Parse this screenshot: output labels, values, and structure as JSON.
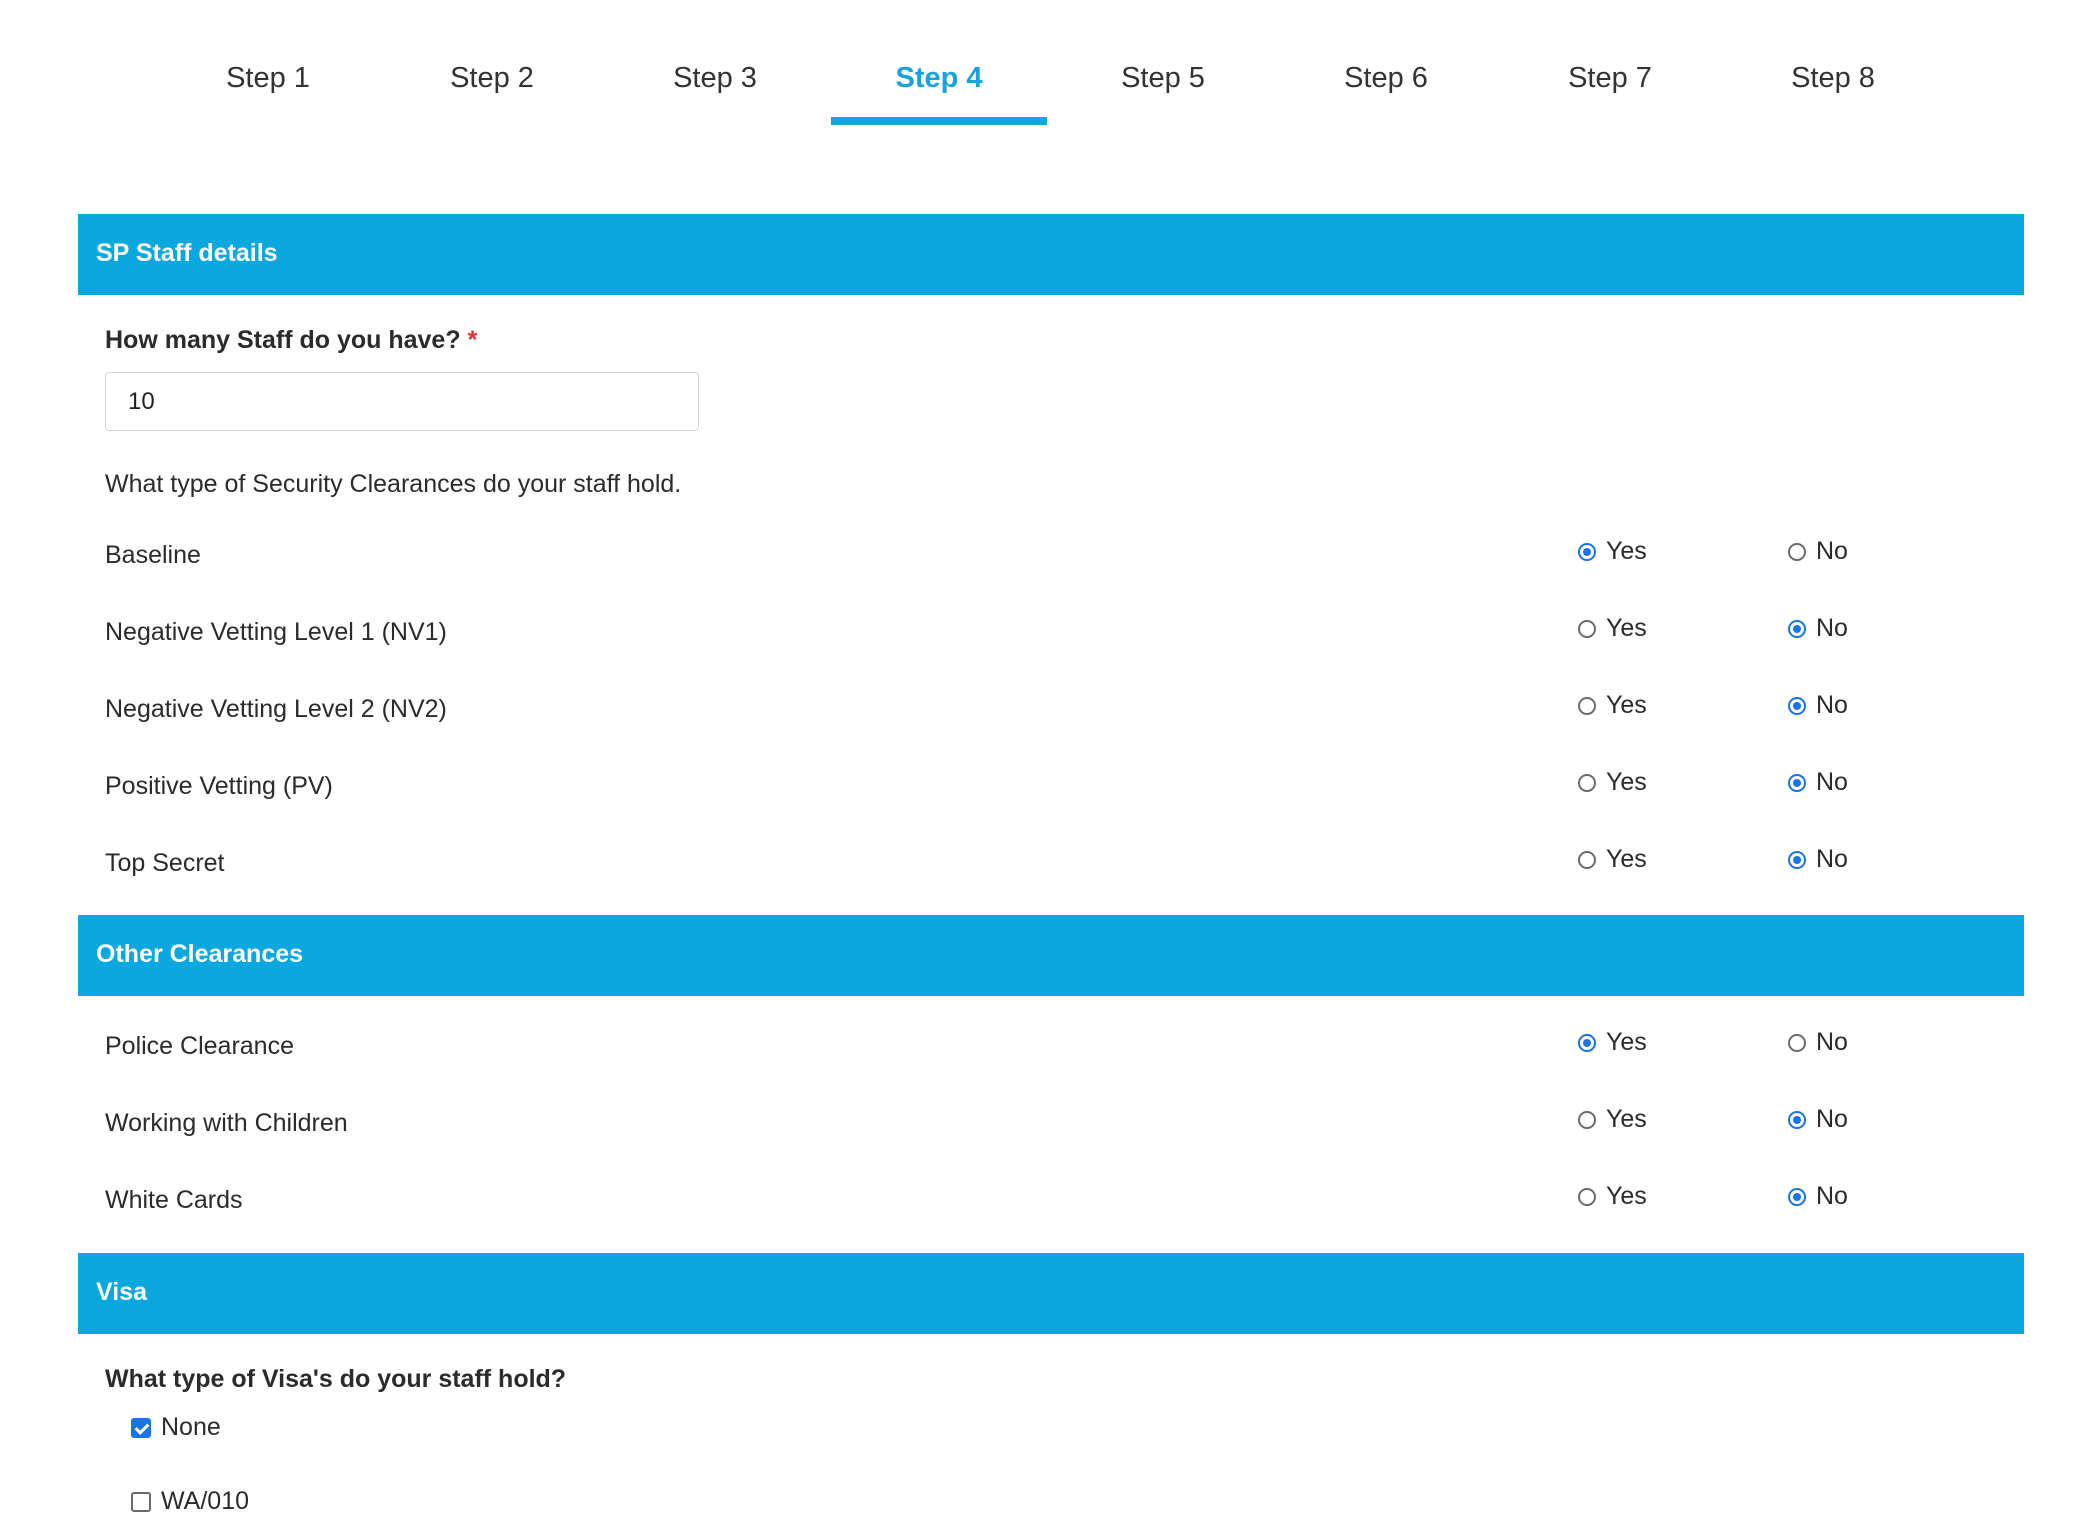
{
  "tabs": [
    {
      "label": "Step 1",
      "active": false
    },
    {
      "label": "Step 2",
      "active": false
    },
    {
      "label": "Step 3",
      "active": false
    },
    {
      "label": "Step 4",
      "active": true
    },
    {
      "label": "Step 5",
      "active": false
    },
    {
      "label": "Step 6",
      "active": false
    },
    {
      "label": "Step 7",
      "active": false
    },
    {
      "label": "Step 8",
      "active": false
    }
  ],
  "colors": {
    "accent": "#0aa8df",
    "active_tab": "#1aa2de",
    "required": "#e03131",
    "control": "#1a73e8"
  },
  "staff_section": {
    "title": "SP Staff details",
    "staff_question": "How many Staff do you have?",
    "required_mark": "*",
    "staff_value": "10",
    "clearance_prompt": "What type of Security Clearances do your staff hold.",
    "clearances": [
      {
        "label": "Baseline",
        "selected": "Yes"
      },
      {
        "label": "Negative Vetting Level 1 (NV1)",
        "selected": "No"
      },
      {
        "label": "Negative Vetting Level 2 (NV2)",
        "selected": "No"
      },
      {
        "label": "Positive Vetting (PV)",
        "selected": "No"
      },
      {
        "label": "Top Secret",
        "selected": "No"
      }
    ]
  },
  "radio_labels": {
    "yes": "Yes",
    "no": "No"
  },
  "other_section": {
    "title": "Other Clearances",
    "items": [
      {
        "label": "Police Clearance",
        "selected": "Yes"
      },
      {
        "label": "Working with Children",
        "selected": "No"
      },
      {
        "label": "White Cards",
        "selected": "No"
      }
    ]
  },
  "visa_section": {
    "title": "Visa",
    "question": "What type of Visa's do your staff hold?",
    "options": [
      {
        "label": "None",
        "checked": true
      },
      {
        "label": "WA/010",
        "checked": false
      }
    ]
  }
}
